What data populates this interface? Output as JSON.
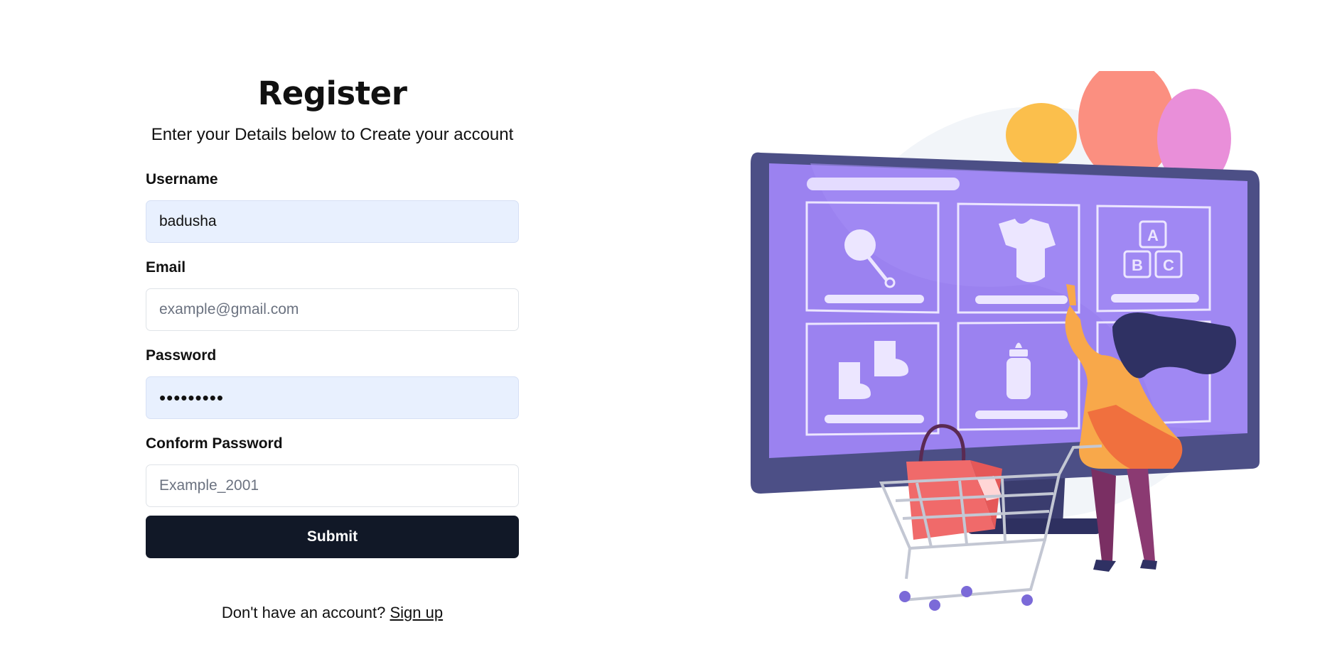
{
  "form": {
    "title": "Register",
    "subtitle": "Enter your Details below to Create your account",
    "username": {
      "label": "Username",
      "value": "badusha"
    },
    "email": {
      "label": "Email",
      "placeholder": "example@gmail.com"
    },
    "password": {
      "label": "Password",
      "value": "•••••••••"
    },
    "confirm": {
      "label": "Conform Password",
      "placeholder": "Example_2001"
    },
    "submit_label": "Submit",
    "footer_text": "Don't have an account?",
    "signup_link": "Sign up"
  },
  "illustration": {
    "tiles": [
      "rattle-icon",
      "bodysuit-icon",
      "abc-blocks-icon",
      "socks-icon",
      "baby-bottle-icon",
      "tile-6"
    ],
    "block_letters": [
      "A",
      "B",
      "C"
    ]
  },
  "colors": {
    "button_bg": "#111827",
    "autofill_bg": "#e8f0fe",
    "screen_purple": "#9b82f0",
    "monitor_frame": "#4c4f86"
  }
}
